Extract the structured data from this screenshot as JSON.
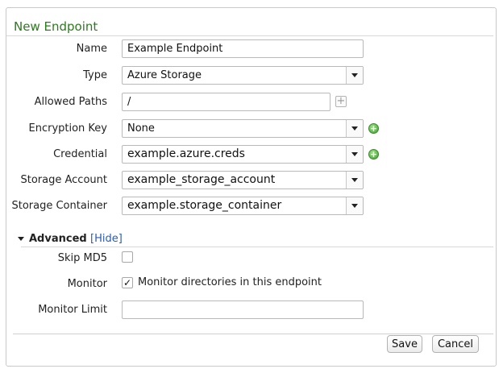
{
  "panel": {
    "title": "New Endpoint"
  },
  "form": {
    "name": {
      "label": "Name",
      "value": "Example Endpoint"
    },
    "type": {
      "label": "Type",
      "value": "Azure Storage"
    },
    "allowed_paths": {
      "label": "Allowed Paths",
      "value": "/"
    },
    "encryption_key": {
      "label": "Encryption Key",
      "value": "None"
    },
    "credential": {
      "label": "Credential",
      "value": "example.azure.creds"
    },
    "storage_account": {
      "label": "Storage Account",
      "value": "example_storage_account"
    },
    "storage_container": {
      "label": "Storage Container",
      "value": "example.storage_container"
    }
  },
  "advanced": {
    "heading": "Advanced",
    "hide_link": "[Hide]",
    "skip_md5": {
      "label": "Skip MD5",
      "checked": false
    },
    "monitor": {
      "label": "Monitor",
      "checked": true,
      "checkbox_text": "Monitor directories in this endpoint"
    },
    "monitor_limit": {
      "label": "Monitor Limit",
      "value": ""
    }
  },
  "buttons": {
    "save": "Save",
    "cancel": "Cancel"
  },
  "icons": {
    "dropdown": "chevron-down-icon",
    "add_path": "plus-icon",
    "add_item": "green-plus-icon",
    "collapse": "triangle-down-icon",
    "check": "checkmark-icon"
  },
  "colors": {
    "title": "#2d7a1f",
    "link": "#2a5db0",
    "add_green": "#3e9f2c"
  }
}
